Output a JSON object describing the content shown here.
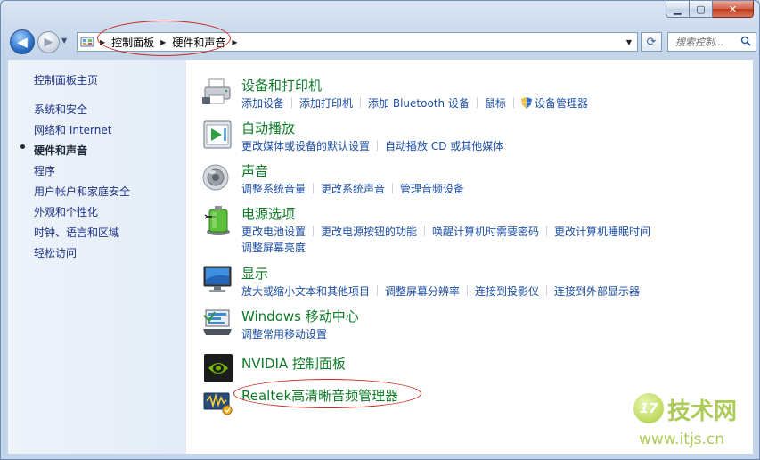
{
  "window": {
    "caption": {
      "minimize": "▁",
      "maximize": "▢",
      "close": "✕"
    }
  },
  "nav": {
    "back_glyph": "◀",
    "forward_glyph": "▶",
    "history_glyph": "▼",
    "breadcrumb": [
      "控制面板",
      "硬件和声音"
    ],
    "dropdown_glyph": "▼",
    "refresh_glyph": "⟳",
    "search_placeholder": "搜索控制..."
  },
  "sidebar": {
    "home": "控制面板主页",
    "items": [
      {
        "label": "系统和安全"
      },
      {
        "label": "网络和 Internet"
      },
      {
        "label": "硬件和声音",
        "active": true
      },
      {
        "label": "程序"
      },
      {
        "label": "用户帐户和家庭安全"
      },
      {
        "label": "外观和个性化"
      },
      {
        "label": "时钟、语言和区域"
      },
      {
        "label": "轻松访问"
      }
    ]
  },
  "categories": [
    {
      "title": "设备和打印机",
      "icon": "printer-icon",
      "links": [
        "添加设备",
        "添加打印机",
        "添加 Bluetooth 设备",
        "鼠标",
        "设备管理器"
      ]
    },
    {
      "title": "自动播放",
      "icon": "autoplay-icon",
      "links": [
        "更改媒体或设备的默认设置",
        "自动播放 CD 或其他媒体"
      ]
    },
    {
      "title": "声音",
      "icon": "speaker-icon",
      "links": [
        "调整系统音量",
        "更改系统声音",
        "管理音频设备"
      ]
    },
    {
      "title": "电源选项",
      "icon": "battery-icon",
      "links": [
        "更改电池设置",
        "更改电源按钮的功能",
        "唤醒计算机时需要密码",
        "更改计算机睡眠时间",
        "调整屏幕亮度"
      ]
    },
    {
      "title": "显示",
      "icon": "monitor-icon",
      "links": [
        "放大或缩小文本和其他项目",
        "调整屏幕分辨率",
        "连接到投影仪",
        "连接到外部显示器"
      ]
    },
    {
      "title": "Windows 移动中心",
      "icon": "mobility-center-icon",
      "links": [
        "调整常用移动设置"
      ]
    },
    {
      "title": "NVIDIA 控制面板",
      "icon": "nvidia-icon",
      "links": []
    },
    {
      "title": "Realtek高清晰音频管理器",
      "icon": "realtek-audio-icon",
      "links": []
    }
  ],
  "watermark": {
    "logo": "17",
    "brand": "技术网",
    "url": "www.itjs.cn"
  },
  "colors": {
    "link": "#1c4ea4",
    "category_title": "#0e7a27",
    "annotation": "#c8281e"
  }
}
